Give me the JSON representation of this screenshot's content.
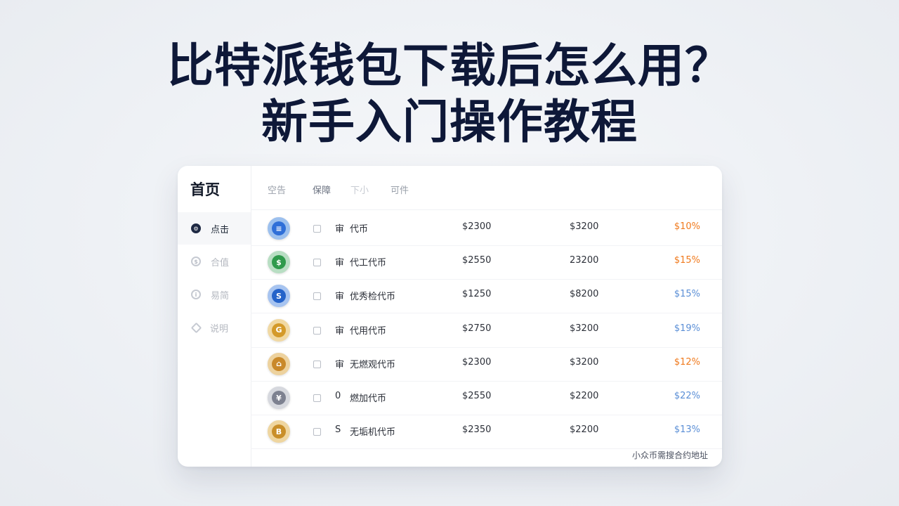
{
  "headline": {
    "line1": "比特派钱包下载后怎么用？",
    "line2": "新手入门操作教程"
  },
  "sidebar": {
    "title": "首页",
    "items": [
      {
        "label": "点击",
        "icon": "settings-icon",
        "active": true
      },
      {
        "label": "合值",
        "icon": "coin-circle-icon",
        "active": false
      },
      {
        "label": "易简",
        "icon": "info-circle-icon",
        "active": false
      },
      {
        "label": "说明",
        "icon": "diamond-icon",
        "active": false
      }
    ]
  },
  "tabs": [
    "空告",
    "保障",
    "下小",
    "可件"
  ],
  "add_button": {
    "label": "+",
    "color": "#f07a1d"
  },
  "colors": {
    "accent": "#f07a1d",
    "change_orange": "#f07a1d",
    "change_blue": "#5b8fd6"
  },
  "rows": [
    {
      "coin_icon": "blue-coin-icon",
      "coin_color": "#2f6fd8",
      "coin_ring": "#9cc0ee",
      "mark": "审",
      "name": "代币",
      "price1": "$2300",
      "price2": "$3200",
      "change": "$10%",
      "change_color": "#f07a1d"
    },
    {
      "coin_icon": "green-coin-icon",
      "coin_color": "#2f9a4c",
      "coin_ring": "#b8dec3",
      "mark": "审",
      "name": "代工代币",
      "price1": "$2550",
      "price2": "23200",
      "change": "$15%",
      "change_color": "#f07a1d"
    },
    {
      "coin_icon": "blue-s-coin-icon",
      "coin_color": "#2563c9",
      "coin_ring": "#a7c4f0",
      "mark": "审",
      "name": "优秀检代币",
      "price1": "$1250",
      "price2": "$8200",
      "change": "$15%",
      "change_color": "#5b8fd6"
    },
    {
      "coin_icon": "gold-coin-icon",
      "coin_color": "#d49a2a",
      "coin_ring": "#f1d9a3",
      "mark": "审",
      "name": "代用代币",
      "price1": "$2750",
      "price2": "$3200",
      "change": "$19%",
      "change_color": "#5b8fd6"
    },
    {
      "coin_icon": "gold-coin-icon",
      "coin_color": "#c9892a",
      "coin_ring": "#edd29e",
      "mark": "审",
      "name": "无燃观代币",
      "price1": "$2300",
      "price2": "$3200",
      "change": "$12%",
      "change_color": "#f07a1d"
    },
    {
      "coin_icon": "silver-coin-icon",
      "coin_color": "#7d8190",
      "coin_ring": "#d6d8de",
      "mark": "0",
      "name": "燃加代币",
      "price1": "$2550",
      "price2": "$2200",
      "change": "$22%",
      "change_color": "#5b8fd6"
    },
    {
      "coin_icon": "gold-coin-icon",
      "coin_color": "#c98f2a",
      "coin_ring": "#efd6a0",
      "mark": "S",
      "name": "无垢机代币",
      "price1": "$2350",
      "price2": "$2200",
      "change": "$13%",
      "change_color": "#5b8fd6"
    }
  ],
  "footer_note": "小众币需搜合约地址"
}
